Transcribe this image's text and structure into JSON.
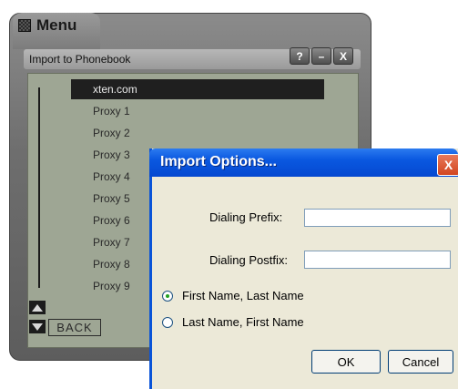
{
  "skin": {
    "menu_title": "Menu",
    "header_title": "Import to Phonebook",
    "controls": {
      "help": "?",
      "minimize": "–",
      "close": "X"
    },
    "back_label": "BACK",
    "list": [
      "xten.com",
      "Proxy 1",
      "Proxy 2",
      "Proxy 3",
      "Proxy 4",
      "Proxy 5",
      "Proxy 6",
      "Proxy 7",
      "Proxy 8",
      "Proxy 9"
    ],
    "selected_index": 0
  },
  "dialog": {
    "title": "Import Options...",
    "close": "X",
    "prefix_label": "Dialing Prefix:",
    "prefix_value": "",
    "postfix_label": "Dialing Postfix:",
    "postfix_value": "",
    "radio_first_last": "First Name, Last Name",
    "radio_last_first": "Last Name, First Name",
    "selected_option": "first_last",
    "ok_label": "OK",
    "cancel_label": "Cancel"
  }
}
